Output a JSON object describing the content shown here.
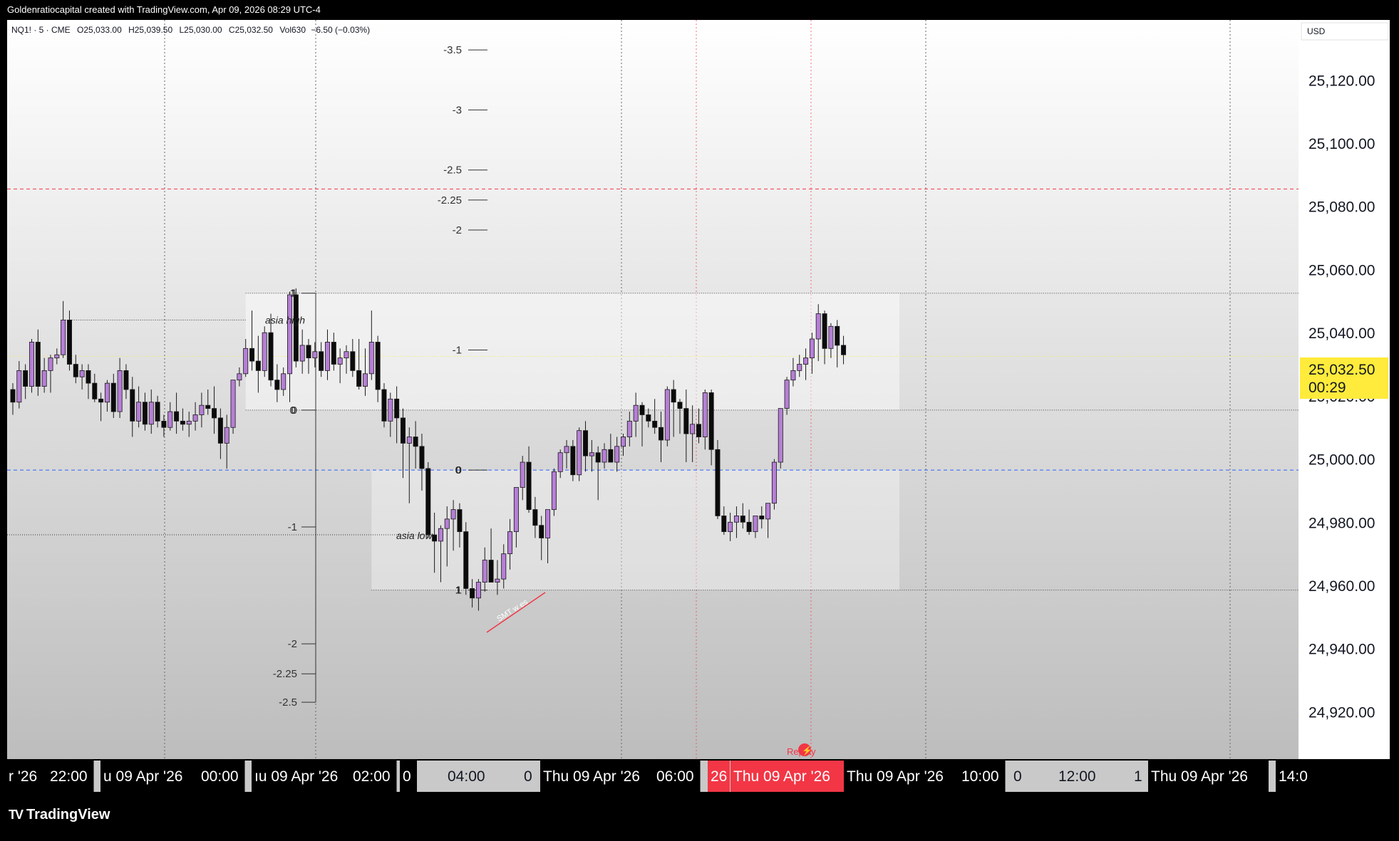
{
  "attribution": "Goldenratiocapital created with TradingView.com, Apr 09, 2026 08:29 UTC-4",
  "brand": "TradingView",
  "legend": {
    "symbol": "NQ1! · 5 · CME",
    "open": "O25,033.00",
    "high": "H25,039.50",
    "low": "L25,030.00",
    "close": "C25,032.50",
    "volume": "Vol630",
    "change": "−6.50 (−0.03%)"
  },
  "currency": "USD",
  "last_price": {
    "price": "25,032.50",
    "countdown": "00:29"
  },
  "colors": {
    "bull_candle": "#b67fd6",
    "bear_candle": "#0b0b0b",
    "price_badge": "#ffeb3b",
    "highlight_time": "#f23645",
    "red_line": "#f23645",
    "blue_line": "#2962ff"
  },
  "annotations": {
    "asia_high": "asia high",
    "asia_low": "asia low",
    "smt": "SMT w es",
    "replay": "Replay",
    "upper_box_top": "1",
    "upper_box_bottom": "0",
    "lower_box_top": "0",
    "lower_box_bottom": "1"
  },
  "chart_data": {
    "type": "candlestick",
    "symbol": "NQ1!",
    "timeframe": "5",
    "ylim": [
      24905,
      25139
    ],
    "y_ticks": [
      "25,120.00",
      "25,100.00",
      "25,080.00",
      "25,060.00",
      "25,040.00",
      "25,020.00",
      "25,000.00",
      "24,980.00",
      "24,960.00",
      "24,940.00",
      "24,920.00"
    ],
    "y_tick_values": [
      25120,
      25100,
      25080,
      25060,
      25040,
      25020,
      25000,
      24980,
      24960,
      24940,
      24920
    ],
    "x_axis_labels": [
      {
        "text": "r '26",
        "boxed": true
      },
      {
        "text": "22:00",
        "boxed": true
      },
      {
        "text": "u 09 Apr '26",
        "boxed": true
      },
      {
        "text": "00:00",
        "boxed": true
      },
      {
        "text": "ıu 09 Apr '26",
        "boxed": true
      },
      {
        "text": "02:00",
        "boxed": true
      },
      {
        "text": "0",
        "boxed": true
      },
      {
        "text": "04:00",
        "boxed": false
      },
      {
        "text": "0",
        "boxed": false
      },
      {
        "text": "Thu 09 Apr '26",
        "boxed": true
      },
      {
        "text": "06:00",
        "boxed": true
      },
      {
        "text": "26",
        "boxed": false,
        "highlight": true
      },
      {
        "text": "Thu 09 Apr '26",
        "boxed": false,
        "highlight": true
      },
      {
        "text": "Thu 09 Apr '26",
        "boxed": true
      },
      {
        "text": "10:00",
        "boxed": true
      },
      {
        "text": "0",
        "boxed": false
      },
      {
        "text": "12:00",
        "boxed": false
      },
      {
        "text": "1",
        "boxed": false
      },
      {
        "text": "Thu 09 Apr '26",
        "boxed": true
      },
      {
        "text": "14:0",
        "boxed": true
      }
    ],
    "candles": [
      [
        25022,
        25024,
        25014,
        25018
      ],
      [
        25018,
        25031,
        25016,
        25028
      ],
      [
        25028,
        25030,
        25019,
        25023
      ],
      [
        25023,
        25038,
        25021,
        25037
      ],
      [
        25037,
        25041,
        25020,
        25023
      ],
      [
        25023,
        25032,
        25021,
        25028
      ],
      [
        25028,
        25033,
        25021,
        25032
      ],
      [
        25032,
        25035,
        25030,
        25033
      ],
      [
        25033,
        25050,
        25032,
        25044
      ],
      [
        25044,
        25047,
        25028,
        25030
      ],
      [
        25030,
        25033,
        25024,
        25026
      ],
      [
        25026,
        25030,
        25022,
        25028
      ],
      [
        25028,
        25030,
        25019,
        25024
      ],
      [
        25024,
        25027,
        25018,
        25019
      ],
      [
        25019,
        25021,
        25012,
        25018
      ],
      [
        25018,
        25025,
        25015,
        25024
      ],
      [
        25024,
        25027,
        25013,
        25015
      ],
      [
        25015,
        25032,
        25013,
        25028
      ],
      [
        25028,
        25030,
        25019,
        25022
      ],
      [
        25022,
        25026,
        25007,
        25012
      ],
      [
        25012,
        25023,
        25010,
        25018
      ],
      [
        25018,
        25021,
        25009,
        25011
      ],
      [
        25011,
        25022,
        25008,
        25018
      ],
      [
        25018,
        25020,
        25010,
        25012
      ],
      [
        25012,
        25014,
        25007,
        25010
      ],
      [
        25010,
        25018,
        25009,
        25015
      ],
      [
        25015,
        25021,
        25008,
        25012
      ],
      [
        25012,
        25016,
        25009,
        25011
      ],
      [
        25011,
        25015,
        25007,
        25012
      ],
      [
        25012,
        25018,
        25009,
        25014
      ],
      [
        25014,
        25021,
        25010,
        25017
      ],
      [
        25017,
        25022,
        25014,
        25016
      ],
      [
        25016,
        25023,
        25008,
        25013
      ],
      [
        25013,
        25016,
        25000,
        25005
      ],
      [
        25005,
        25014,
        24997,
        25010
      ],
      [
        25010,
        25023,
        25008,
        25025
      ],
      [
        25025,
        25029,
        25023,
        25027
      ],
      [
        25027,
        25038,
        25026,
        25035
      ],
      [
        25035,
        25047,
        25028,
        25031
      ],
      [
        25031,
        25039,
        25021,
        25028
      ],
      [
        25028,
        25042,
        25026,
        25040
      ],
      [
        25040,
        25046,
        25023,
        25025
      ],
      [
        25025,
        25030,
        25018,
        25022
      ],
      [
        25022,
        25029,
        25020,
        25027
      ],
      [
        25027,
        25053,
        25018,
        25052
      ],
      [
        25052,
        25054,
        25029,
        25031
      ],
      [
        25031,
        25041,
        25027,
        25036
      ],
      [
        25036,
        25038,
        25027,
        25032
      ],
      [
        25032,
        25037,
        25029,
        25034
      ],
      [
        25034,
        25037,
        25026,
        25028
      ],
      [
        25028,
        25041,
        25025,
        25037
      ],
      [
        25037,
        25040,
        25028,
        25030
      ],
      [
        25030,
        25035,
        25024,
        25032
      ],
      [
        25032,
        25036,
        25027,
        25034
      ],
      [
        25034,
        25038,
        25026,
        25028
      ],
      [
        25028,
        25038,
        25022,
        25023
      ],
      [
        25023,
        25035,
        25020,
        25027
      ],
      [
        25027,
        25047,
        25025,
        25037
      ],
      [
        25037,
        25039,
        25018,
        25022
      ],
      [
        25022,
        25024,
        25010,
        25012
      ],
      [
        25012,
        25021,
        25007,
        25019
      ],
      [
        25019,
        25023,
        25005,
        25013
      ],
      [
        25013,
        25016,
        24994,
        25005
      ],
      [
        25005,
        25010,
        24986,
        25007
      ],
      [
        25007,
        25012,
        24997,
        25004
      ],
      [
        25004,
        25008,
        24990,
        24997
      ],
      [
        24997,
        24999,
        24975,
        24976
      ],
      [
        24976,
        24983,
        24964,
        24974
      ],
      [
        24974,
        24979,
        24961,
        24978
      ],
      [
        24978,
        24985,
        24966,
        24981
      ],
      [
        24981,
        24987,
        24971,
        24984
      ],
      [
        24984,
        24986,
        24972,
        24977
      ],
      [
        24977,
        24980,
        24957,
        24959
      ],
      [
        24959,
        24962,
        24953,
        24956
      ],
      [
        24956,
        24962,
        24952,
        24961
      ],
      [
        24961,
        24972,
        24958,
        24968
      ],
      [
        24968,
        24978,
        24962,
        24961
      ],
      [
        24961,
        24968,
        24957,
        24962
      ],
      [
        24962,
        24973,
        24959,
        24970
      ],
      [
        24970,
        24981,
        24965,
        24977
      ],
      [
        24977,
        24986,
        24972,
        24991
      ],
      [
        24991,
        25001,
        24987,
        24999
      ],
      [
        24999,
        25004,
        24983,
        24984
      ],
      [
        24984,
        24988,
        24975,
        24979
      ],
      [
        24979,
        24982,
        24968,
        24975
      ],
      [
        24975,
        24982,
        24967,
        24984
      ],
      [
        24984,
        24997,
        24982,
        24996
      ],
      [
        24996,
        25003,
        24994,
        25002
      ],
      [
        25002,
        25006,
        24997,
        25004
      ],
      [
        25004,
        25006,
        24993,
        24995
      ],
      [
        24995,
        25010,
        24993,
        25009
      ],
      [
        25009,
        25012,
        24996,
        25001
      ],
      [
        25001,
        25006,
        24996,
        25002
      ],
      [
        25002,
        25004,
        24987,
        24999
      ],
      [
        24999,
        25005,
        24997,
        25003
      ],
      [
        25003,
        25008,
        24999,
        24999
      ],
      [
        24999,
        25007,
        24996,
        25004
      ],
      [
        25004,
        25008,
        25001,
        25007
      ],
      [
        25007,
        25015,
        25004,
        25012
      ],
      [
        25012,
        25021,
        25007,
        25017
      ],
      [
        25017,
        25018,
        25004,
        25014
      ],
      [
        25014,
        25016,
        25010,
        25012
      ],
      [
        25012,
        25019,
        25008,
        25010
      ],
      [
        25010,
        25015,
        24999,
        25006
      ],
      [
        25006,
        25023,
        25004,
        25022
      ],
      [
        25022,
        25025,
        25007,
        25018
      ],
      [
        25018,
        25019,
        25008,
        25016
      ],
      [
        25016,
        25022,
        24999,
        25008
      ],
      [
        25008,
        25017,
        24999,
        25011
      ],
      [
        25011,
        25016,
        25005,
        25007
      ],
      [
        25007,
        25022,
        25003,
        25021
      ],
      [
        25021,
        25022,
        24998,
        25003
      ],
      [
        25003,
        25006,
        24981,
        24982
      ],
      [
        24982,
        24985,
        24976,
        24977
      ],
      [
        24977,
        24983,
        24974,
        24980
      ],
      [
        24980,
        24985,
        24975,
        24982
      ],
      [
        24982,
        24986,
        24978,
        24980
      ],
      [
        24980,
        24984,
        24976,
        24977
      ],
      [
        24977,
        24980,
        24975,
        24982
      ],
      [
        24982,
        24985,
        24978,
        24981
      ],
      [
        24981,
        24984,
        24975,
        24986
      ],
      [
        24986,
        25000,
        24984,
        24999
      ],
      [
        24999,
        25016,
        24997,
        25016
      ],
      [
        25016,
        25026,
        25014,
        25025
      ],
      [
        25025,
        25032,
        25023,
        25028
      ],
      [
        25028,
        25033,
        25026,
        25030
      ],
      [
        25030,
        25035,
        25025,
        25032
      ],
      [
        25032,
        25040,
        25027,
        25038
      ],
      [
        25038,
        25049,
        25031,
        25046
      ],
      [
        25046,
        25047,
        25030,
        25035
      ],
      [
        25035,
        25043,
        25032,
        25042
      ],
      [
        25042,
        25044,
        25029,
        25036
      ],
      [
        25036,
        25039,
        25030,
        25033
      ]
    ],
    "horizontal_lines": [
      {
        "price": 25085.5,
        "color": "#f23645",
        "style": "dashed"
      },
      {
        "price": 24996.5,
        "color": "#2962ff",
        "style": "dashed"
      },
      {
        "price": 25032.5,
        "color": "#ffeb3b",
        "style": "dotted"
      }
    ],
    "fibonacci_upper": {
      "levels": [
        {
          "label": "1",
          "price": 25052.5
        },
        {
          "label": "0",
          "price": 25015.5
        },
        {
          "label": "-1",
          "price": 24978.5
        },
        {
          "label": "-2",
          "price": 24941.5
        },
        {
          "label": "-2.25",
          "price": 24932.0
        },
        {
          "label": "-2.5",
          "price": 24923.0
        }
      ]
    },
    "fibonacci_lower": {
      "levels": [
        {
          "label": "0",
          "price": 24996.5
        },
        {
          "label": "1",
          "price": 24958.5
        },
        {
          "label": "-1",
          "price": 25034.5
        },
        {
          "label": "-2",
          "price": 25072.5
        },
        {
          "label": "-2.25",
          "price": 25082.0
        },
        {
          "label": "-2.5",
          "price": 25091.5
        },
        {
          "label": "-3",
          "price": 25110.5
        },
        {
          "label": "-3.5",
          "price": 25129.5
        }
      ]
    },
    "asia_high": 25044.0,
    "asia_low": 24976.0,
    "grid": true
  }
}
